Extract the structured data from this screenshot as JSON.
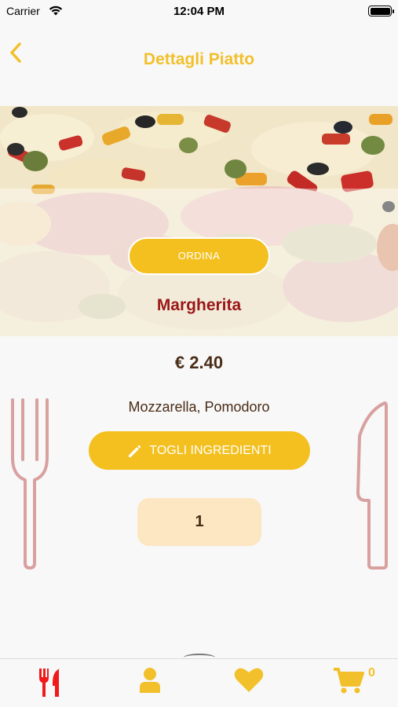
{
  "status_bar": {
    "carrier": "Carrier",
    "time": "12:04 PM"
  },
  "header": {
    "title": "Dettagli Piatto",
    "back_icon": "chevron-left-icon"
  },
  "hero": {
    "order_label": "ORDINA",
    "dish_name": "Margherita"
  },
  "details": {
    "price": "€ 2.40",
    "ingredients": "Mozzarella, Pomodoro",
    "remove_label": "TOGLI INGREDIENTI",
    "quantity": "1"
  },
  "tabbar": {
    "items": [
      {
        "icon": "fork-knife-icon",
        "color": "#f01a1a"
      },
      {
        "icon": "user-icon",
        "color": "#f2c02b"
      },
      {
        "icon": "heart-icon",
        "color": "#f2c02b"
      },
      {
        "icon": "cart-icon",
        "color": "#f2c02b"
      }
    ],
    "cart_count": "0"
  },
  "colors": {
    "accent": "#f2c02b",
    "button": "#f4c01f",
    "dish_name": "#9a1717",
    "text": "#4a2c17",
    "cutlery": "#d9a0a0"
  }
}
